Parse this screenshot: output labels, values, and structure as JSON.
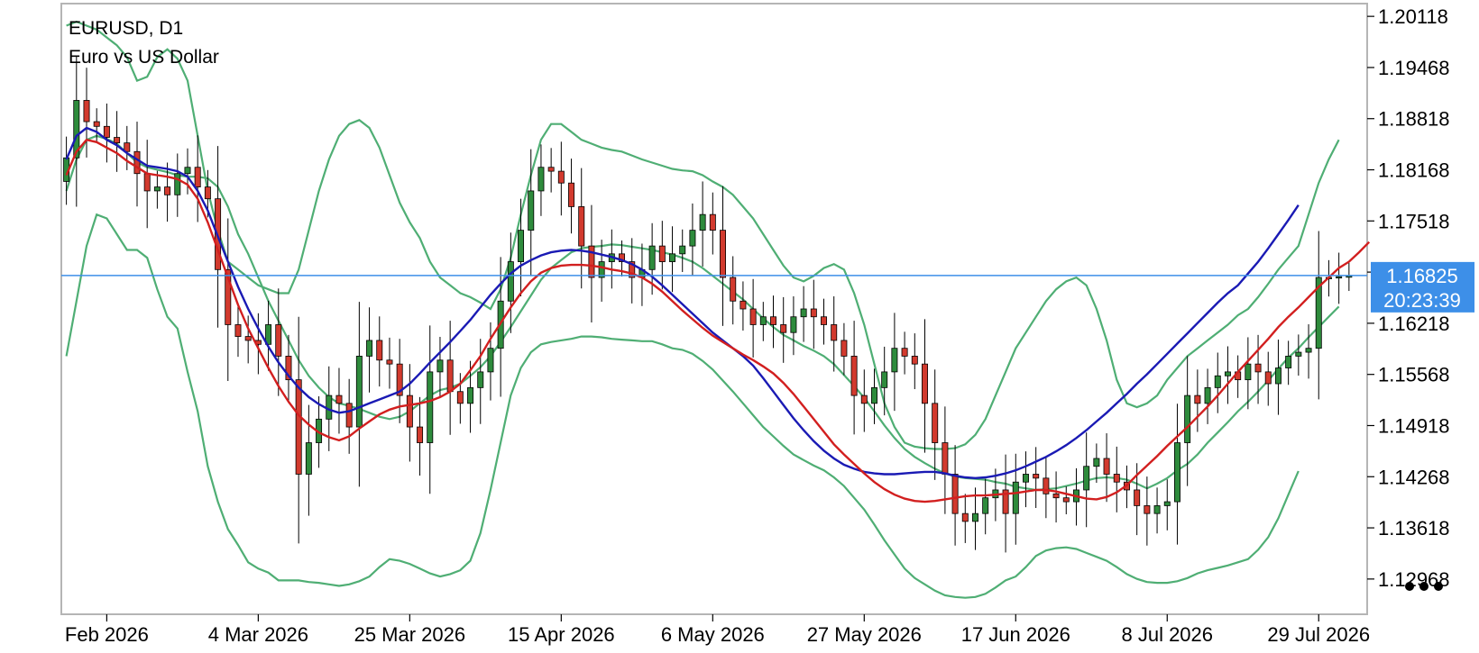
{
  "header": {
    "symbol_line": "EURUSD, D1",
    "description_line": "Euro vs US Dollar"
  },
  "price_tag": {
    "price": "1.16825",
    "countdown": "20:23:39",
    "level": 1.16825,
    "color": "#3d8fe8"
  },
  "menu": {
    "more_icon": "ellipsis-icon"
  },
  "colors": {
    "bull": "#2e8b3c",
    "bear": "#d23a2e",
    "wick": "#000000",
    "bands": "#4fae74",
    "ma_fast": "#d21f1f",
    "ma_slow": "#1a1ab4",
    "price_line": "#3d8fe8",
    "frame": "#b5b5b5"
  },
  "chart_data": {
    "type": "candlestick",
    "title": "EURUSD, D1",
    "subtitle": "Euro vs US Dollar",
    "ylim": [
      1.1252,
      1.2028
    ],
    "y_ticks": [
      1.20118,
      1.19468,
      1.18818,
      1.18168,
      1.17518,
      1.16868,
      1.16218,
      1.15568,
      1.14918,
      1.14268,
      1.13618,
      1.12968
    ],
    "y_tick_labels": [
      "1.20118",
      "1.19468",
      "1.18818",
      "1.18168",
      "1.17518",
      "",
      "1.16218",
      "1.15568",
      "1.14918",
      "1.14268",
      "1.13618",
      "1.12968"
    ],
    "x_ticks": [
      {
        "index": 4,
        "label": "Feb 2026"
      },
      {
        "index": 19,
        "label": "4 Mar 2026"
      },
      {
        "index": 34,
        "label": "25 Mar 2026"
      },
      {
        "index": 49,
        "label": "15 Apr 2026"
      },
      {
        "index": 64,
        "label": "6 May 2026"
      },
      {
        "index": 79,
        "label": "27 May 2026"
      },
      {
        "index": 94,
        "label": "17 Jun 2026"
      },
      {
        "index": 109,
        "label": "8 Jul 2026"
      },
      {
        "index": 124,
        "label": "29 Jul 2026"
      }
    ],
    "closes": [
      1.1832,
      1.1905,
      1.1878,
      1.1872,
      1.1858,
      1.1851,
      1.184,
      1.1812,
      1.179,
      1.1795,
      1.1785,
      1.1812,
      1.182,
      1.1795,
      1.178,
      1.169,
      1.162,
      1.1605,
      1.16,
      1.1595,
      1.162,
      1.158,
      1.155,
      1.143,
      1.147,
      1.15,
      1.153,
      1.152,
      1.149,
      1.158,
      1.16,
      1.1575,
      1.157,
      1.153,
      1.149,
      1.147,
      1.156,
      1.1575,
      1.1535,
      1.152,
      1.154,
      1.156,
      1.159,
      1.165,
      1.17,
      1.174,
      1.179,
      1.182,
      1.1815,
      1.18,
      1.177,
      1.172,
      1.168,
      1.17,
      1.171,
      1.17,
      1.168,
      1.169,
      1.172,
      1.17,
      1.171,
      1.172,
      1.174,
      1.176,
      1.174,
      1.168,
      1.165,
      1.164,
      1.162,
      1.163,
      1.162,
      1.161,
      1.163,
      1.164,
      1.163,
      1.162,
      1.16,
      1.158,
      1.153,
      1.152,
      1.154,
      1.156,
      1.159,
      1.158,
      1.157,
      1.152,
      1.147,
      1.143,
      1.138,
      1.137,
      1.138,
      1.14,
      1.141,
      1.138,
      1.142,
      1.143,
      1.1425,
      1.1405,
      1.14,
      1.1395,
      1.141,
      1.144,
      1.145,
      1.143,
      1.142,
      1.141,
      1.139,
      1.138,
      1.139,
      1.1395,
      1.147,
      1.153,
      1.152,
      1.154,
      1.1555,
      1.156,
      1.155,
      1.157,
      1.156,
      1.1545,
      1.1565,
      1.158,
      1.1585,
      1.159,
      1.168,
      1.168,
      1.1681,
      1.1682
    ],
    "upper_band": [
      1.2,
      1.2005,
      1.2,
      1.1995,
      1.1985,
      1.1975,
      1.196,
      1.193,
      1.1935,
      1.196,
      1.197,
      1.1958,
      1.193,
      1.186,
      1.179,
      1.174,
      1.17,
      1.169,
      1.168,
      1.167,
      1.1665,
      1.166,
      1.166,
      1.169,
      1.174,
      1.179,
      1.183,
      1.186,
      1.1875,
      1.188,
      1.187,
      1.1845,
      1.181,
      1.1775,
      1.175,
      1.173,
      1.17,
      1.168,
      1.167,
      1.166,
      1.1655,
      1.1648,
      1.164,
      1.1665,
      1.1705,
      1.176,
      1.181,
      1.1855,
      1.1875,
      1.1875,
      1.1865,
      1.1855,
      1.185,
      1.1845,
      1.1842,
      1.184,
      1.1835,
      1.183,
      1.1826,
      1.1822,
      1.1818,
      1.1816,
      1.1815,
      1.181,
      1.1802,
      1.1795,
      1.1785,
      1.177,
      1.1755,
      1.1735,
      1.1715,
      1.1695,
      1.168,
      1.1675,
      1.1682,
      1.1692,
      1.1697,
      1.169,
      1.166,
      1.162,
      1.157,
      1.152,
      1.149,
      1.147,
      1.1465,
      1.1463,
      1.1462,
      1.1462,
      1.1463,
      1.1468,
      1.148,
      1.15,
      1.153,
      1.156,
      1.159,
      1.161,
      1.163,
      1.165,
      1.1665,
      1.1675,
      1.168,
      1.167,
      1.164,
      1.16,
      1.155,
      1.152,
      1.1515,
      1.152,
      1.153,
      1.155,
      1.1565,
      1.158,
      1.159,
      1.16,
      1.161,
      1.162,
      1.1632,
      1.164,
      1.1655,
      1.1672,
      1.169,
      1.1705,
      1.172,
      1.176,
      1.18,
      1.183,
      1.1855
    ],
    "middle_band": [
      1.179,
      1.183,
      1.1855,
      1.186,
      1.1856,
      1.185,
      1.1838,
      1.1826,
      1.182,
      1.1817,
      1.1814,
      1.181,
      1.1808,
      1.1808,
      1.1806,
      1.1795,
      1.177,
      1.1735,
      1.171,
      1.168,
      1.165,
      1.1625,
      1.16,
      1.1575,
      1.1555,
      1.154,
      1.1528,
      1.152,
      1.1517,
      1.1513,
      1.1508,
      1.1503,
      1.15,
      1.1503,
      1.151,
      1.152,
      1.153,
      1.1537,
      1.154,
      1.1545,
      1.1555,
      1.1566,
      1.158,
      1.1598,
      1.1617,
      1.1637,
      1.1657,
      1.1677,
      1.1692,
      1.1702,
      1.1712,
      1.1717,
      1.1719,
      1.172,
      1.1722,
      1.1721,
      1.1719,
      1.1717,
      1.1715,
      1.1712,
      1.1709,
      1.1705,
      1.17,
      1.1692,
      1.1682,
      1.1672,
      1.1662,
      1.1652,
      1.164,
      1.1628,
      1.1617,
      1.1607,
      1.16,
      1.1593,
      1.1587,
      1.158,
      1.157,
      1.1556,
      1.1542,
      1.1527,
      1.151,
      1.1492,
      1.1476,
      1.1462,
      1.1452,
      1.1444,
      1.1437,
      1.1431,
      1.1427,
      1.1425,
      1.1424,
      1.1423,
      1.142,
      1.1418,
      1.1414,
      1.1412,
      1.141,
      1.1411,
      1.1412,
      1.1415,
      1.1418,
      1.1422,
      1.1425,
      1.1426,
      1.1425,
      1.1423,
      1.1418,
      1.1412,
      1.1418,
      1.1425,
      1.1435,
      1.1443,
      1.1455,
      1.147,
      1.1483,
      1.1496,
      1.151,
      1.1522,
      1.1535,
      1.1549,
      1.1564,
      1.1578,
      1.159,
      1.1604,
      1.1617,
      1.163,
      1.1643
    ],
    "lower_band": [
      1.158,
      1.165,
      1.172,
      1.176,
      1.1755,
      1.1735,
      1.1715,
      1.1715,
      1.1705,
      1.1665,
      1.163,
      1.1615,
      1.156,
      1.151,
      1.144,
      1.1395,
      1.136,
      1.134,
      1.1318,
      1.131,
      1.1305,
      1.1295,
      1.1295,
      1.1295,
      1.1293,
      1.1292,
      1.129,
      1.1288,
      1.129,
      1.1294,
      1.13,
      1.1312,
      1.1322,
      1.132,
      1.1316,
      1.131,
      1.1304,
      1.13,
      1.1303,
      1.1308,
      1.132,
      1.1355,
      1.141,
      1.147,
      1.153,
      1.1565,
      1.1585,
      1.1595,
      1.1598,
      1.16,
      1.1602,
      1.1605,
      1.1605,
      1.1604,
      1.1602,
      1.1601,
      1.16,
      1.1599,
      1.1599,
      1.1595,
      1.159,
      1.1588,
      1.1583,
      1.1574,
      1.1563,
      1.1549,
      1.1535,
      1.152,
      1.1505,
      1.149,
      1.1478,
      1.1466,
      1.1455,
      1.1448,
      1.1441,
      1.1435,
      1.1426,
      1.1415,
      1.14,
      1.1385,
      1.1366,
      1.1346,
      1.1328,
      1.131,
      1.1298,
      1.129,
      1.1282,
      1.1276,
      1.1274,
      1.1273,
      1.1274,
      1.1278,
      1.1286,
      1.1295,
      1.13,
      1.1312,
      1.1326,
      1.1333,
      1.1336,
      1.1337,
      1.1335,
      1.133,
      1.1325,
      1.132,
      1.1312,
      1.1303,
      1.1297,
      1.1293,
      1.1292,
      1.1292,
      1.1294,
      1.1298,
      1.1304,
      1.1308,
      1.1311,
      1.1314,
      1.1318,
      1.1322,
      1.1334,
      1.135,
      1.1374,
      1.1404,
      1.1434
    ],
    "ma_fast": [
      1.181,
      1.184,
      1.1855,
      1.1852,
      1.1845,
      1.1838,
      1.1828,
      1.182,
      1.1812,
      1.181,
      1.1808,
      1.1805,
      1.1798,
      1.178,
      1.175,
      1.1715,
      1.168,
      1.1645,
      1.1615,
      1.159,
      1.1565,
      1.1542,
      1.1522,
      1.1505,
      1.1493,
      1.1483,
      1.1477,
      1.1473,
      1.1478,
      1.1488,
      1.1497,
      1.1506,
      1.1512,
      1.1516,
      1.1518,
      1.152,
      1.1523,
      1.1528,
      1.1535,
      1.1545,
      1.1562,
      1.158,
      1.1602,
      1.1622,
      1.1642,
      1.166,
      1.1675,
      1.1686,
      1.1692,
      1.1695,
      1.1696,
      1.1696,
      1.1695,
      1.1693,
      1.169,
      1.1688,
      1.1685,
      1.168,
      1.1672,
      1.1662,
      1.165,
      1.1638,
      1.1627,
      1.1616,
      1.1606,
      1.1598,
      1.159,
      1.1582,
      1.1575,
      1.1567,
      1.1558,
      1.1546,
      1.1532,
      1.1516,
      1.15,
      1.1484,
      1.1468,
      1.1455,
      1.1443,
      1.1431,
      1.142,
      1.1411,
      1.1404,
      1.1399,
      1.1396,
      1.1395,
      1.1396,
      1.1398,
      1.14,
      1.1402,
      1.1403,
      1.1403,
      1.1404,
      1.1405,
      1.1406,
      1.1408,
      1.141,
      1.141,
      1.1408,
      1.1405,
      1.1402,
      1.1399,
      1.1398,
      1.1401,
      1.1407,
      1.1416,
      1.1429,
      1.1441,
      1.1453,
      1.1466,
      1.1478,
      1.149,
      1.1503,
      1.1516,
      1.153,
      1.1545,
      1.156,
      1.1574,
      1.1588,
      1.1602,
      1.1617,
      1.163,
      1.1642,
      1.1655,
      1.1668,
      1.168,
      1.1692,
      1.17,
      1.1712,
      1.1725
    ],
    "ma_slow": [
      1.183,
      1.186,
      1.187,
      1.1865,
      1.1855,
      1.1848,
      1.1838,
      1.183,
      1.1822,
      1.182,
      1.1818,
      1.1815,
      1.1808,
      1.179,
      1.1765,
      1.1732,
      1.17,
      1.1668,
      1.164,
      1.1615,
      1.1592,
      1.1572,
      1.1555,
      1.154,
      1.1528,
      1.1519,
      1.1512,
      1.1508,
      1.151,
      1.1515,
      1.152,
      1.1525,
      1.153,
      1.1535,
      1.1545,
      1.1558,
      1.1572,
      1.1585,
      1.1598,
      1.1612,
      1.1626,
      1.1642,
      1.1658,
      1.1672,
      1.1685,
      1.1695,
      1.1702,
      1.1708,
      1.1712,
      1.1714,
      1.1715,
      1.1714,
      1.1712,
      1.1709,
      1.1706,
      1.1702,
      1.1697,
      1.169,
      1.1681,
      1.167,
      1.1658,
      1.1646,
      1.1634,
      1.1622,
      1.161,
      1.16,
      1.159,
      1.158,
      1.1568,
      1.1552,
      1.1535,
      1.1518,
      1.1501,
      1.1486,
      1.1472,
      1.146,
      1.145,
      1.1442,
      1.1437,
      1.1433,
      1.1431,
      1.143,
      1.143,
      1.1431,
      1.1432,
      1.1433,
      1.1433,
      1.1431,
      1.1428,
      1.1426,
      1.1425,
      1.1426,
      1.1428,
      1.1431,
      1.1435,
      1.144,
      1.1446,
      1.1452,
      1.1459,
      1.1467,
      1.1476,
      1.1486,
      1.1497,
      1.1508,
      1.152,
      1.1532,
      1.1545,
      1.1557,
      1.157,
      1.1583,
      1.1596,
      1.1609,
      1.1622,
      1.1635,
      1.1648,
      1.166,
      1.167,
      1.1685,
      1.17,
      1.1717,
      1.1735,
      1.1753,
      1.1772
    ]
  }
}
